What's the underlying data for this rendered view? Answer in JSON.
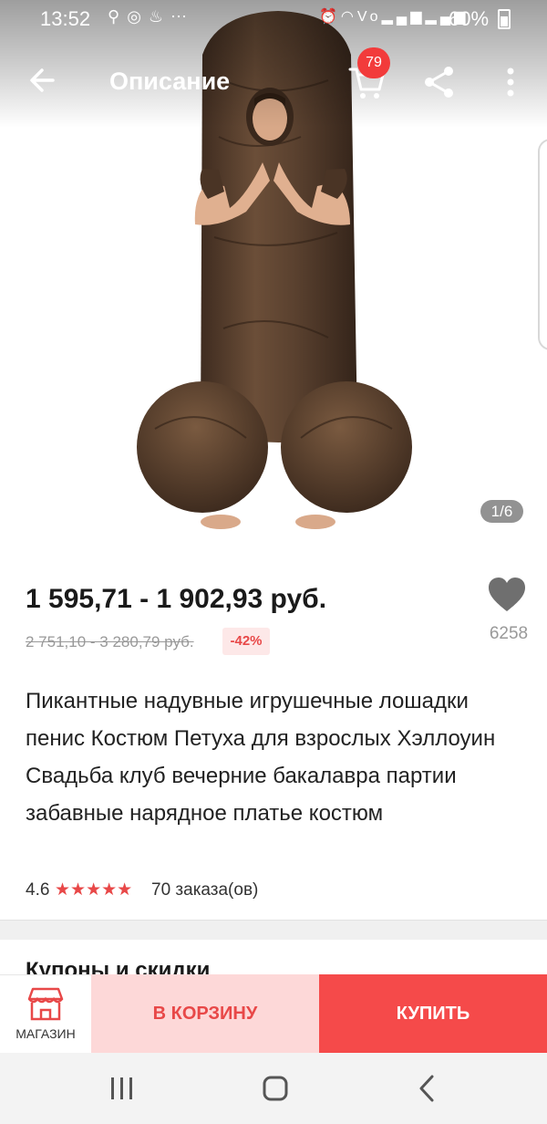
{
  "status_bar": {
    "time": "13:52",
    "left_icons": [
      "search-icon",
      "sber-icon",
      "notification-icon",
      "more-dots-icon"
    ],
    "right_icons": [
      "alarm-icon",
      "wifi-icon",
      "volte-icon",
      "signal-icon",
      "signal-icon"
    ],
    "battery": "60%"
  },
  "app_bar": {
    "title": "Описание",
    "cart_badge": "79"
  },
  "gallery": {
    "counter": "1/6"
  },
  "price": {
    "current": "1 595,71 - 1 902,93 руб.",
    "old": "2 751,10 - 3 280,79 руб.",
    "discount": "-42%"
  },
  "favorite": {
    "count": "6258"
  },
  "product": {
    "title": "Пикантные надувные игрушечные лошадки пенис Костюм Петуха для взрослых Хэллоуин Свадьба клуб вечерние бакалавра партии забавные нарядное платье костюм"
  },
  "rating": {
    "value": "4.6",
    "stars": "★★★★★",
    "orders": "70 заказа(ов)"
  },
  "sections": {
    "coupons": "Купоны и скидки"
  },
  "actions": {
    "shop": "МАГАЗИН",
    "add_to_cart": "В КОРЗИНУ",
    "buy": "КУПИТЬ"
  },
  "colors": {
    "accent": "#f54a4a",
    "accent_light": "#fdd8d8",
    "badge": "#f23b3b",
    "costume_brown": "#5e4330"
  }
}
